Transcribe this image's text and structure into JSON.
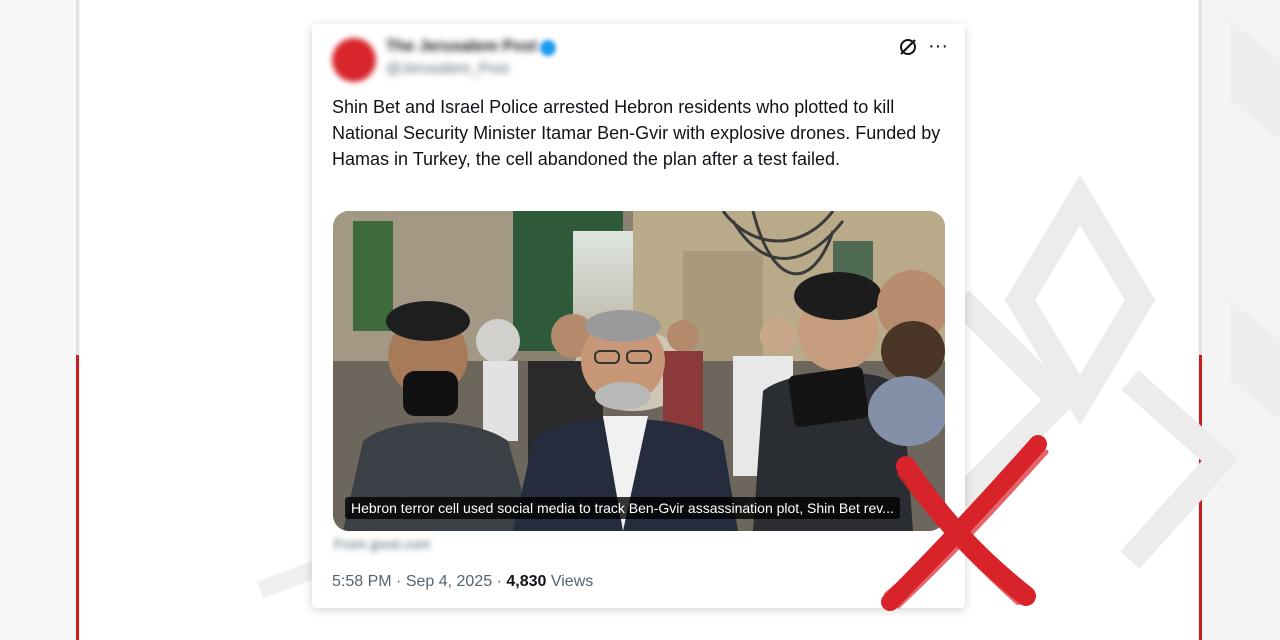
{
  "tweet": {
    "account_name": "The Jerusalem Post",
    "account_handle": "@Jerusalem_Post",
    "text": "Shin Bet and Israel Police arrested Hebron residents who plotted to kill National Security Minister Itamar Ben-Gvir with explosive drones. Funded by Hamas in Turkey, the cell abandoned the plan after a test failed.",
    "media_caption": "Hebron terror cell used social media to track Ben-Gvir assassination plot, Shin Bet rev...",
    "source_link": "From jpost.com",
    "time": "5:58 PM",
    "separator": "·",
    "date": "Sep 4, 2025",
    "views_count": "4,830",
    "views_label": "Views"
  },
  "icons": {
    "grok": "grok-icon",
    "more": "more-icon",
    "verified": "verified-badge-icon",
    "false_mark": "red-x-icon"
  },
  "colors": {
    "accent_red": "#c81e1e",
    "verified_blue": "#1d9bf0",
    "text_primary": "#0f1419",
    "text_secondary": "#536471"
  }
}
